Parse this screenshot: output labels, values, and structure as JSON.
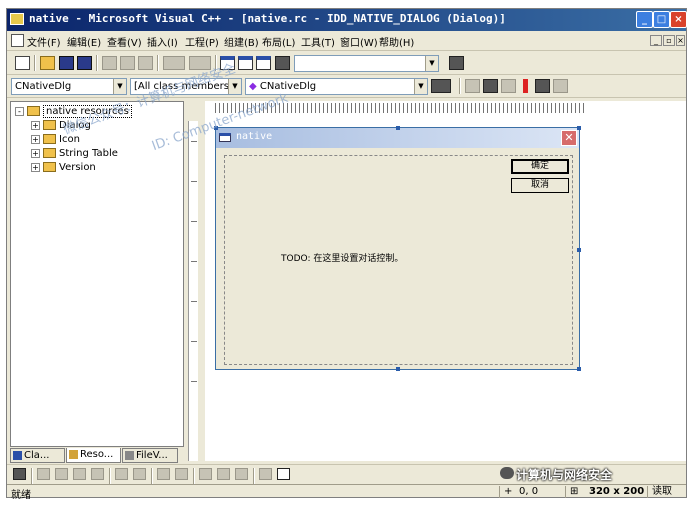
{
  "window": {
    "title": "native - Microsoft Visual C++ - [native.rc - IDD_NATIVE_DIALOG (Dialog)]"
  },
  "menubar": {
    "items": [
      "文件(F)",
      "编辑(E)",
      "查看(V)",
      "插入(I)",
      "工程(P)",
      "组建(B)",
      "布局(L)",
      "工具(T)",
      "窗口(W)",
      "帮助(H)"
    ]
  },
  "wizardbar": {
    "class_combo": "CNativeDlg",
    "members_combo": "[All class members]",
    "function_combo": "CNativeDlg"
  },
  "workspace": {
    "root": "native resources",
    "nodes": [
      "Dialog",
      "Icon",
      "String Table",
      "Version"
    ],
    "tabs": [
      "Cla...",
      "Reso...",
      "FileV..."
    ]
  },
  "dialog": {
    "title": "native",
    "ok_label": "确定",
    "cancel_label": "取消",
    "todo_text": "TODO: 在这里设置对话控制。"
  },
  "watermark": {
    "line1": "微信公众号：计算机与网络安全",
    "line2": "ID: Computer-network"
  },
  "statusbar": {
    "ready": "就绪",
    "coords": "0, 0",
    "size": "320 x 200",
    "mode": "读取"
  },
  "brand": "计算机与网络安全",
  "colors": {
    "titlebar": "#0a246a",
    "dialog_face": "#ece9d8",
    "close_red": "#d9422b"
  }
}
